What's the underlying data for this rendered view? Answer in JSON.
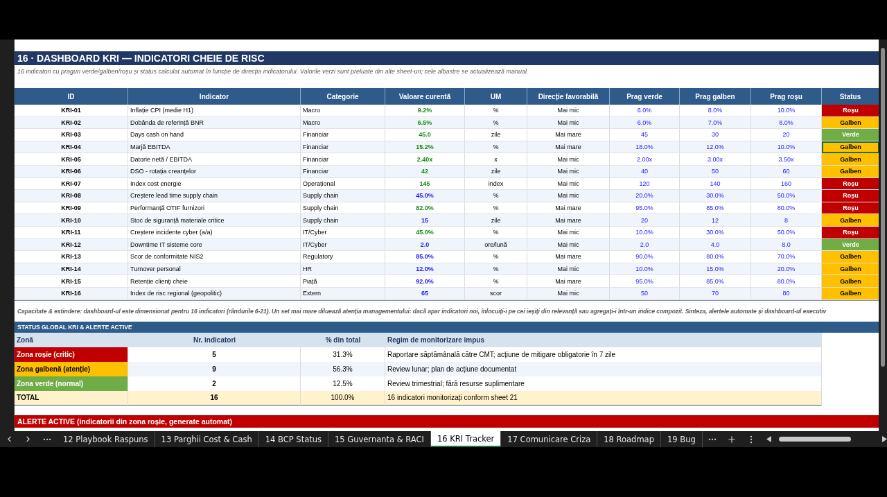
{
  "title": "16 · DASHBOARD KRI — INDICATORI CHEIE DE RISC",
  "subtitle": "16 indicatori cu praguri verde/galben/roșu și status calculat automat în funcție de direcția indicatorului. Valorile verzi sunt preluate din alte sheet-uri; cele albastre se actualizează manual.",
  "table": {
    "columns": [
      "ID",
      "Indicator",
      "Categorie",
      "Valoare curentă",
      "UM",
      "Direcție favorabilă",
      "Prag verde",
      "Prag galben",
      "Prag roșu",
      "Status"
    ],
    "rows": [
      {
        "id": "KRI-01",
        "indicator": "Inflație CPI (medie H1)",
        "category": "Macro",
        "value": "9.2%",
        "kind": "linked",
        "unit": "%",
        "direction": "Mai mic",
        "green": "6.0%",
        "yellow": "8.0%",
        "red": "10.0%",
        "status": "Roșu",
        "color": "#c00000",
        "selected": false
      },
      {
        "id": "KRI-02",
        "indicator": "Dobânda de referință BNR",
        "category": "Macro",
        "value": "6.5%",
        "kind": "linked",
        "unit": "%",
        "direction": "Mai mic",
        "green": "6.0%",
        "yellow": "7.0%",
        "red": "8.0%",
        "status": "Galben",
        "color": "#ffc000",
        "selected": false
      },
      {
        "id": "KRI-03",
        "indicator": "Days cash on hand",
        "category": "Financiar",
        "value": "45.0",
        "kind": "linked",
        "unit": "zile",
        "direction": "Mai mare",
        "green": "45",
        "yellow": "30",
        "red": "20",
        "status": "Verde",
        "color": "#70ad47",
        "selected": false
      },
      {
        "id": "KRI-04",
        "indicator": "Marjă EBITDA",
        "category": "Financiar",
        "value": "15.2%",
        "kind": "linked",
        "unit": "%",
        "direction": "Mai mare",
        "green": "18.0%",
        "yellow": "12.0%",
        "red": "10.0%",
        "status": "Galben",
        "color": "#ffc000",
        "selected": true
      },
      {
        "id": "KRI-05",
        "indicator": "Datorie netă / EBITDA",
        "category": "Financiar",
        "value": "2.40x",
        "kind": "linked",
        "unit": "x",
        "direction": "Mai mic",
        "green": "2.00x",
        "yellow": "3.00x",
        "red": "3.50x",
        "status": "Galben",
        "color": "#ffc000",
        "selected": false
      },
      {
        "id": "KRI-06",
        "indicator": "DSO - rotația creanțelor",
        "category": "Financiar",
        "value": "42",
        "kind": "linked",
        "unit": "zile",
        "direction": "Mai mic",
        "green": "40",
        "yellow": "50",
        "red": "60",
        "status": "Galben",
        "color": "#ffc000",
        "selected": false
      },
      {
        "id": "KRI-07",
        "indicator": "Index cost energie",
        "category": "Operațional",
        "value": "145",
        "kind": "linked",
        "unit": "index",
        "direction": "Mai mic",
        "green": "120",
        "yellow": "140",
        "red": "160",
        "status": "Roșu",
        "color": "#c00000",
        "selected": false
      },
      {
        "id": "KRI-08",
        "indicator": "Creștere lead time supply chain",
        "category": "Supply chain",
        "value": "45.0%",
        "kind": "manual",
        "unit": "%",
        "direction": "Mai mic",
        "green": "20.0%",
        "yellow": "30.0%",
        "red": "50.0%",
        "status": "Roșu",
        "color": "#c00000",
        "selected": false
      },
      {
        "id": "KRI-09",
        "indicator": "Performanță OTIF furnizori",
        "category": "Supply chain",
        "value": "82.0%",
        "kind": "linked",
        "unit": "%",
        "direction": "Mai mare",
        "green": "95.0%",
        "yellow": "85.0%",
        "red": "80.0%",
        "status": "Roșu",
        "color": "#c00000",
        "selected": false
      },
      {
        "id": "KRI-10",
        "indicator": "Stoc de siguranță materiale critice",
        "category": "Supply chain",
        "value": "15",
        "kind": "manual",
        "unit": "zile",
        "direction": "Mai mare",
        "green": "20",
        "yellow": "12",
        "red": "8",
        "status": "Galben",
        "color": "#ffc000",
        "selected": false
      },
      {
        "id": "KRI-11",
        "indicator": "Creștere incidente cyber (a/a)",
        "category": "IT/Cyber",
        "value": "45.0%",
        "kind": "linked",
        "unit": "%",
        "direction": "Mai mic",
        "green": "10.0%",
        "yellow": "30.0%",
        "red": "50.0%",
        "status": "Roșu",
        "color": "#c00000",
        "selected": false
      },
      {
        "id": "KRI-12",
        "indicator": "Downtime IT sisteme core",
        "category": "IT/Cyber",
        "value": "2.0",
        "kind": "manual",
        "unit": "ore/lună",
        "direction": "Mai mic",
        "green": "2.0",
        "yellow": "4.0",
        "red": "8.0",
        "status": "Verde",
        "color": "#70ad47",
        "selected": false
      },
      {
        "id": "KRI-13",
        "indicator": "Scor de conformitate NIS2",
        "category": "Regulatory",
        "value": "85.0%",
        "kind": "manual",
        "unit": "%",
        "direction": "Mai mare",
        "green": "90.0%",
        "yellow": "80.0%",
        "red": "70.0%",
        "status": "Galben",
        "color": "#ffc000",
        "selected": false
      },
      {
        "id": "KRI-14",
        "indicator": "Turnover personal",
        "category": "HR",
        "value": "12.0%",
        "kind": "manual",
        "unit": "%",
        "direction": "Mai mic",
        "green": "10.0%",
        "yellow": "15.0%",
        "red": "20.0%",
        "status": "Galben",
        "color": "#ffc000",
        "selected": false
      },
      {
        "id": "KRI-15",
        "indicator": "Retenție clienți cheie",
        "category": "Piață",
        "value": "92.0%",
        "kind": "manual",
        "unit": "%",
        "direction": "Mai mare",
        "green": "95.0%",
        "yellow": "85.0%",
        "red": "80.0%",
        "status": "Galben",
        "color": "#ffc000",
        "selected": false
      },
      {
        "id": "KRI-16",
        "indicator": "Index de risc regional (geopolitic)",
        "category": "Extern",
        "value": "65",
        "kind": "manual",
        "unit": "scor",
        "direction": "Mai mic",
        "green": "50",
        "yellow": "70",
        "red": "80",
        "status": "Galben",
        "color": "#ffc000",
        "selected": false
      }
    ]
  },
  "note": "Capacitate & extindere: dashboard-ul este dimensionat pentru 16 indicatori (rândurile 6-21). Un set mai mare diluează atenția managementului: dacă apar indicatori noi, înlocuiți-i pe cei ieșiți din relevanță sau agregați-i într-un indice compozit. Sinteza, alertele automate și dashboard-ul executiv",
  "summary": {
    "title": "STATUS GLOBAL KRI & ALERTE ACTIVE",
    "columns": [
      "Zonă",
      "Nr. indicatori",
      "% din total",
      "Regim de monitorizare impus"
    ],
    "rows": [
      {
        "zone": "Zona roșie (critic)",
        "kind": "red",
        "count": "5",
        "share": "31.3%",
        "regime": "Raportare săptămânală către CMT; acțiune de mitigare obligatorie în 7 zile"
      },
      {
        "zone": "Zona galbenă (atenție)",
        "kind": "yellow",
        "count": "9",
        "share": "56.3%",
        "regime": "Review lunar; plan de acțiune documentat"
      },
      {
        "zone": "Zona verde (normal)",
        "kind": "green",
        "count": "2",
        "share": "12.5%",
        "regime": "Review trimestrial; fără resurse suplimentare"
      },
      {
        "zone": "TOTAL",
        "kind": "total",
        "count": "16",
        "share": "100.0%",
        "regime": "16 indicatori monitorizați conform sheet 21"
      }
    ]
  },
  "alerts": {
    "title": "ALERTE ACTIVE (indicatorii din zona roșie, generate automat)"
  },
  "sheet_tabs": [
    {
      "label": "12 Playbook Raspuns",
      "selected": false
    },
    {
      "label": "13 Parghii Cost & Cash",
      "selected": false
    },
    {
      "label": "14 BCP Status",
      "selected": false
    },
    {
      "label": "15 Guvernanta & RACI",
      "selected": false
    },
    {
      "label": "16 KRI Tracker",
      "selected": true
    },
    {
      "label": "17 Comunicare Criza",
      "selected": false
    },
    {
      "label": "18 Roadmap",
      "selected": false
    },
    {
      "label": "19 Bug",
      "selected": false
    }
  ]
}
